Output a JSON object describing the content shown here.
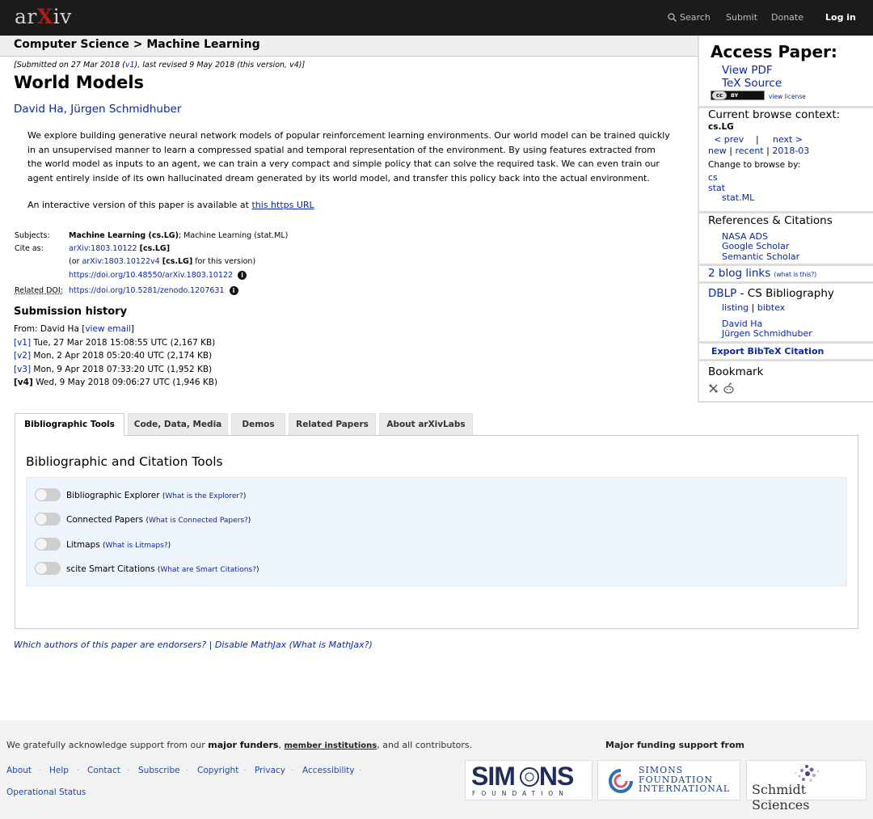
{
  "topbar": {
    "logo_pre": "ar",
    "logo_x": "X",
    "logo_post": "iv",
    "search": "Search",
    "submit": "Submit",
    "donate": "Donate",
    "login": "Log in"
  },
  "breadcrumb": "Computer Science > Machine Learning",
  "paper": {
    "dateline_pre": "[Submitted on 27 Mar 2018 (",
    "dateline_v1": "v1",
    "dateline_post": "), last revised 9 May 2018 (this version, v4)]",
    "title": "World Models",
    "authors": "David Ha, Jürgen Schmidhuber",
    "abstract": "We explore building generative neural network models of popular reinforcement learning environments. Our world model can be trained quickly in an unsupervised manner to learn a compressed spatial and temporal representation of the environment. By using features extracted from the world model as inputs to an agent, we can train a very compact and simple policy that can solve the required task. We can even train our agent entirely inside of its own hallucinated dream generated by its world model, and transfer this policy back into the actual environment.",
    "interactive_pre": "An interactive version of this paper is available at ",
    "interactive_link": "this https URL"
  },
  "metadata": {
    "subjects_label": "Subjects:",
    "subjects_primary": "Machine Learning (cs.LG)",
    "subjects_rest": "; Machine Learning (stat.ML)",
    "cite_label": "Cite as:",
    "cite_id": "arXiv:1803.10122",
    "cite_cat": "[cs.LG]",
    "cite_or_pre": "(or ",
    "cite_version": "arXiv:1803.10122v4",
    "cite_version_cat": "[cs.LG]",
    "cite_or_post": " for this version)",
    "doi": "https://doi.org/10.48550/arXiv.1803.10122",
    "related_doi_label": "Related DOI:",
    "related_doi": "https://doi.org/10.5281/zenodo.1207631",
    "info_glyph": "i"
  },
  "history": {
    "title": "Submission history",
    "from_pre": "From: David Ha [",
    "from_link": "view email",
    "from_post": "]",
    "versions": [
      {
        "tag": "[v1]",
        "text": " Tue, 27 Mar 2018 15:08:55 UTC (2,167 KB)"
      },
      {
        "tag": "[v2]",
        "text": " Mon, 2 Apr 2018 05:20:40 UTC (2,174 KB)"
      },
      {
        "tag": "[v3]",
        "text": " Mon, 9 Apr 2018 07:33:20 UTC (1,952 KB)"
      },
      {
        "tag": "[v4]",
        "text": " Wed, 9 May 2018 09:06:27 UTC (1,946 KB)"
      }
    ]
  },
  "tabs": [
    "Bibliographic Tools",
    "Code, Data, Media",
    "Demos",
    "Related Papers",
    "About arXivLabs"
  ],
  "tools": {
    "title": "Bibliographic and Citation Tools",
    "items": [
      {
        "label": "Bibliographic Explorer",
        "what": "What is the Explorer?"
      },
      {
        "label": "Connected Papers",
        "what": "What is Connected Papers?"
      },
      {
        "label": "Litmaps",
        "what": "What is Litmaps?"
      },
      {
        "label": "scite Smart Citations",
        "what": "What are Smart Citations?"
      }
    ]
  },
  "endorsers": {
    "q": "Which authors of this paper are endorsers?",
    "sep": " | ",
    "disable": "Disable MathJax",
    "what": "(What is MathJax?)"
  },
  "sidebar": {
    "access_title": "Access Paper:",
    "view_pdf": "View PDF",
    "tex_source": "TeX Source",
    "cc_left": "cc",
    "cc_right": "BY",
    "view_license": "view license",
    "context_title": "Current browse context:",
    "context_cat": "cs.LG",
    "prev": "< prev",
    "pipe": "|",
    "next": "next >",
    "nav_new": "new",
    "nav_recent": "recent",
    "nav_month": "2018-03",
    "change_browse": "Change to browse by:",
    "browse_cs": "cs",
    "browse_stat": "stat",
    "browse_statml": "stat.ML",
    "refs_title": "References & Citations",
    "nasa_ads": "NASA ADS",
    "google_scholar": "Google Scholar",
    "semantic_scholar": "Semantic Scholar",
    "blog_links": "2 blog links",
    "blog_what": "(what is this?)",
    "dblp_title_link": "DBLP",
    "dblp_title_rest": " - CS Bibliography",
    "dblp_listing": "listing",
    "dblp_bibtex": "bibtex",
    "dblp_author1": "David Ha",
    "dblp_author2": "Jürgen Schmidhuber",
    "export_bibtex": "Export BibTeX Citation",
    "bookmark_title": "Bookmark"
  },
  "footer": {
    "ack_pre": "We gratefully acknowledge support from our ",
    "ack_funders": "major funders",
    "ack_comma": ", ",
    "ack_members": "member institutions",
    "ack_post": ", and all contributors.",
    "funding_label": "Major funding support from",
    "links": [
      "About",
      "Help",
      "Contact",
      "Subscribe",
      "Copyright",
      "Privacy",
      "Accessibility"
    ],
    "dot": "·",
    "op_status": "Operational Status",
    "simons_a": "SIM",
    "simons_b": "NS",
    "simons_sub": "FOUNDATION",
    "sfi_line1": "SIMONS",
    "sfi_line2": "FOUNDATION",
    "sfi_line3": "INTERNATIONAL",
    "schmidt": "Schmidt Sciences"
  },
  "colors": {
    "link": "#0b27a4",
    "arxiv_red": "#b31b1b",
    "topbar": "#1b1b1b",
    "tools_bg": "#eef4fb"
  }
}
